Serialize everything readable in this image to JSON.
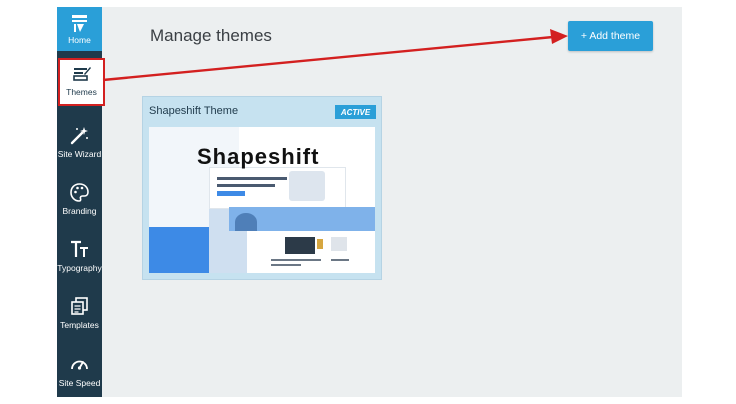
{
  "sidebar": {
    "items": [
      {
        "label": "Home",
        "icon": "home-icon"
      },
      {
        "label": "Themes",
        "icon": "themes-icon"
      },
      {
        "label": "Site Wizard",
        "icon": "magic-wand-icon"
      },
      {
        "label": "Branding",
        "icon": "palette-icon"
      },
      {
        "label": "Typography",
        "icon": "typography-icon"
      },
      {
        "label": "Templates",
        "icon": "templates-icon"
      },
      {
        "label": "Site Speed",
        "icon": "speedometer-icon"
      }
    ]
  },
  "main": {
    "title": "Manage themes",
    "add_button": "+ Add theme"
  },
  "theme_card": {
    "name": "Shapeshift Theme",
    "badge": "ACTIVE",
    "preview_logo": "Shapeshift"
  },
  "colors": {
    "sidebar_bg": "#1f3a4b",
    "accent": "#2a9fd8",
    "highlight": "#d32020"
  }
}
